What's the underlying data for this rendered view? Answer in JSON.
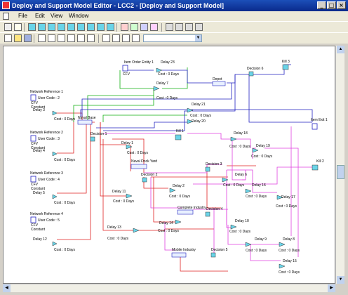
{
  "window": {
    "title": "Deploy and Support Model Editor - LCC2 - [Deploy and Support Model]",
    "min": "_",
    "max": "□",
    "close": "×"
  },
  "menu": [
    "File",
    "Edit",
    "View",
    "Window"
  ],
  "toolbar": {
    "combo_value": ""
  },
  "entities": [
    {
      "name": "Network Reference 1",
      "details": [
        "User Code : 2",
        "CFV",
        "Constant"
      ],
      "delay": "Delay 3",
      "cost": "Cost : 0 Days"
    },
    {
      "name": "Network Reference 2",
      "details": [
        "User Code : 3",
        "CFV",
        "Constant"
      ],
      "delay": "Delay 4",
      "cost": "Cost : 0 Days"
    },
    {
      "name": "Network Reference 3",
      "details": [
        "User Code : 4",
        "CFV",
        "Constant"
      ],
      "delay": "Delay 5",
      "cost": "Cost : 0 Days"
    },
    {
      "name": "Network Reference 4",
      "details": [
        "User Code : 5",
        "CFV",
        "Constant"
      ],
      "delay": "Delay 12",
      "cost": "Cost : 0 Days"
    }
  ],
  "item_order": {
    "name": "Item Order Entity 1",
    "detail": "CFV"
  },
  "delays": [
    {
      "name": "Delay 23",
      "cost": "Cost : 0 Days"
    },
    {
      "name": "Delay 7",
      "cost": "Cost : 0 Days"
    },
    {
      "name": "Delay 21",
      "cost": "Cost : 0 Days"
    },
    {
      "name": "Delay 20",
      "cost": "Cost : 0 Days"
    },
    {
      "name": "Delay 1",
      "cost": "Cost : 0 Days"
    },
    {
      "name": "Delay 2",
      "cost": "Cost : 0 Days"
    },
    {
      "name": "Delay 11",
      "cost": "Cost : 0 Days"
    },
    {
      "name": "Delay 13",
      "cost": "Cost : 0 Days"
    },
    {
      "name": "Delay 14",
      "cost": "Cost : 0 Days"
    },
    {
      "name": "Delay 19",
      "cost": "Cost : 0 Days"
    },
    {
      "name": "Delay 18",
      "cost": "Cost : 0 Days"
    },
    {
      "name": "Delay 6",
      "cost": "Cost : 0 Days"
    },
    {
      "name": "Delay 16",
      "cost": "Cost : 0 Days"
    },
    {
      "name": "Delay 17",
      "cost": "Cost : 0 Days"
    },
    {
      "name": "Delay 10",
      "cost": "Cost : 0 Days"
    },
    {
      "name": "Delay 9",
      "cost": "Cost : 0 Days"
    },
    {
      "name": "Delay 8",
      "cost": "Cost : 0 Days"
    },
    {
      "name": "Delay 15",
      "cost": "Cost : 0 Days"
    }
  ],
  "depots": [
    "Depot",
    "Naval Base",
    "Naval Dock Yard",
    "Complete Industry",
    "Mobile Industry"
  ],
  "decisions": [
    "Decision 6",
    "Decision 1",
    "Decision 2",
    "Decision 3",
    "Decision 4",
    "Decision 5"
  ],
  "kills": [
    "Kill 3",
    "Kill 1",
    "Kill 2"
  ],
  "item_exit": "Item Exit 1",
  "colors": {
    "red": "#e02020",
    "green": "#10b010",
    "blue": "#2020c0",
    "magenta": "#e040e0",
    "node": "#6ad4e8"
  }
}
